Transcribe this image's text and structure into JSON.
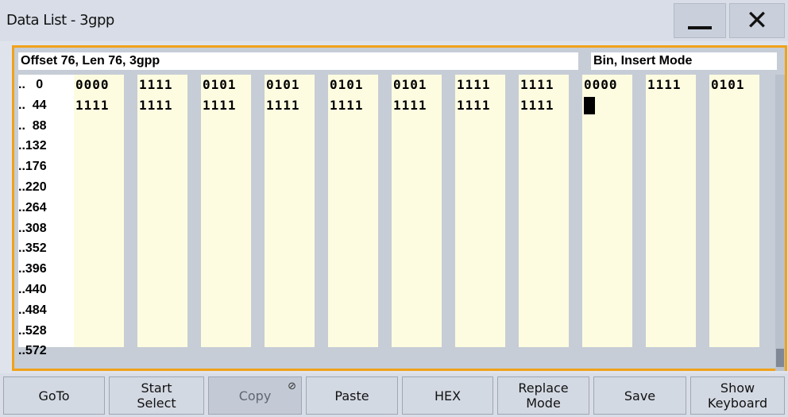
{
  "window": {
    "title": "Data List - 3gpp",
    "minimize_icon": "minimize-icon",
    "close_icon": "close-icon",
    "close_glyph": "✕"
  },
  "editor": {
    "info_left": "Offset 76, Len 76,  3gpp",
    "info_right": "Bin, Insert Mode",
    "offsets": [
      ".. 0",
      ".. 44",
      ".. 88",
      "..132",
      "..176",
      "..220",
      "..264",
      "..308",
      "..352",
      "..396",
      "..440",
      "..484",
      "..528",
      "..572"
    ],
    "rows": [
      [
        "0000",
        "1111",
        "0101",
        "0101",
        "0101",
        "0101",
        "1111",
        "1111",
        "0000",
        "1111",
        "0101"
      ],
      [
        "1111",
        "1111",
        "1111",
        "1111",
        "1111",
        "1111",
        "1111",
        "1111",
        "",
        "",
        ""
      ]
    ],
    "cursor_row": 1,
    "cursor_col": 8,
    "colors": {
      "highlight_border": "#f0a21a",
      "cell_background": "#fefce0",
      "panel_background": "#c6cdd6"
    }
  },
  "softkeys": [
    {
      "label": "GoTo",
      "enabled": true
    },
    {
      "label": "Start\nSelect",
      "enabled": true
    },
    {
      "label": "Copy",
      "enabled": false,
      "badge": "⊘",
      "badge_icon": "no-entry-icon"
    },
    {
      "label": "Paste",
      "enabled": true
    },
    {
      "label": "HEX",
      "enabled": true
    },
    {
      "label": "Replace\nMode",
      "enabled": true
    },
    {
      "label": "Save",
      "enabled": true
    },
    {
      "label": "Show\nKeyboard",
      "enabled": true
    }
  ]
}
